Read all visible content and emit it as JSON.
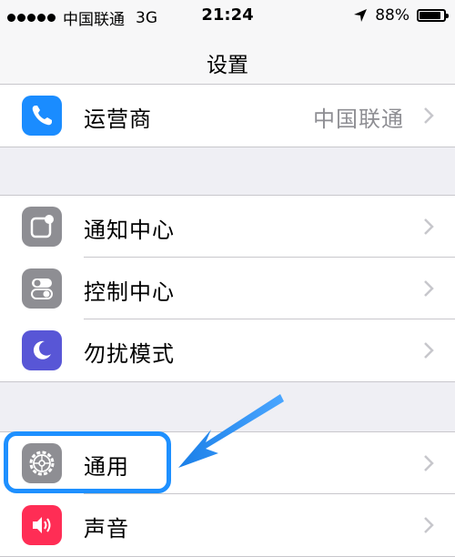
{
  "status_bar": {
    "carrier": "中国联通",
    "network": "3G",
    "time": "21:24",
    "battery": "88%",
    "battery_level": 0.88
  },
  "nav": {
    "title": "设置"
  },
  "rows": {
    "carrier": {
      "label": "运营商",
      "value": "中国联通"
    },
    "notifications": {
      "label": "通知中心"
    },
    "control_center": {
      "label": "控制中心"
    },
    "do_not_disturb": {
      "label": "勿扰模式"
    },
    "general": {
      "label": "通用"
    },
    "sounds": {
      "label": "声音"
    }
  },
  "colors": {
    "phone_icon": "#1a8cff",
    "gray_icon": "#8e8e93",
    "moon_icon": "#5856d6",
    "sound_icon": "#ff2d55",
    "highlight": "#1e90ff"
  },
  "icons": {
    "carrier": "phone-icon",
    "notifications": "notification-center-icon",
    "control_center": "control-center-icon",
    "do_not_disturb": "moon-icon",
    "general": "gear-icon",
    "sounds": "speaker-icon"
  }
}
